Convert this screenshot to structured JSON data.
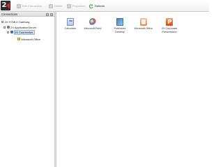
{
  "toolbar": {
    "logo": "2X",
    "buttons": [
      {
        "label": "Edit Connection",
        "state": "disabled"
      },
      {
        "label": "Delete",
        "state": "disabled"
      },
      {
        "label": "Properties",
        "state": "disabled"
      },
      {
        "label": "Refresh",
        "state": "enabled"
      }
    ]
  },
  "left_panel": {
    "title": "Connections",
    "tree": [
      {
        "label": "2X HTML5 Gateway",
        "expanded": true
      },
      {
        "label": "2X ApplicationServer",
        "expanded": true
      },
      {
        "label": "2X Connection",
        "expanded": true,
        "selected": true
      },
      {
        "label": "Microsoft Office"
      }
    ]
  },
  "apps": [
    {
      "name": "Calculator"
    },
    {
      "name": "Microsoft Paint"
    },
    {
      "name": "Published\nDesktop"
    },
    {
      "name": "Microsoft Office"
    },
    {
      "name": "2X Corporate\nPresentation"
    }
  ],
  "colors": {
    "selection": "#c9ddf3",
    "logo_bg": "#2b2b2b",
    "logo_accent": "#e2231a"
  }
}
